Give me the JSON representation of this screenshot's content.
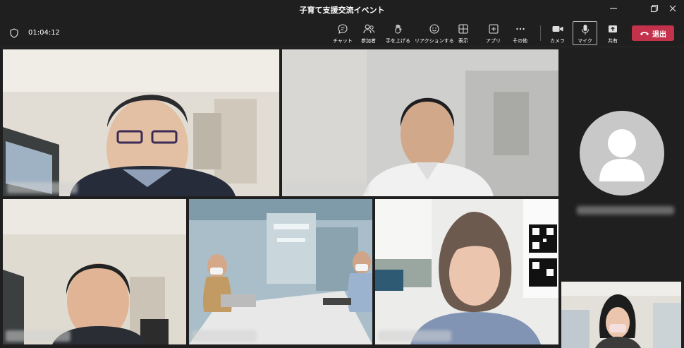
{
  "window": {
    "title": "子育て支援交流イベント",
    "minimize_icon": "minimize-icon",
    "restore_icon": "restore-icon",
    "close_icon": "close-icon"
  },
  "toolbar": {
    "timer": "01:04:12",
    "buttons": {
      "chat": "チャット",
      "people": "参加者",
      "raise_hand": "手を上げる",
      "reactions": "リアクションする",
      "view": "表示",
      "apps": "アプリ",
      "more": "その他",
      "camera": "カメラ",
      "mic": "マイク",
      "share": "共有"
    },
    "leave": "退出"
  },
  "colors": {
    "background": "#1f1f1f",
    "leave_button": "#c4314b",
    "avatar_bg": "#c8c8c8"
  }
}
